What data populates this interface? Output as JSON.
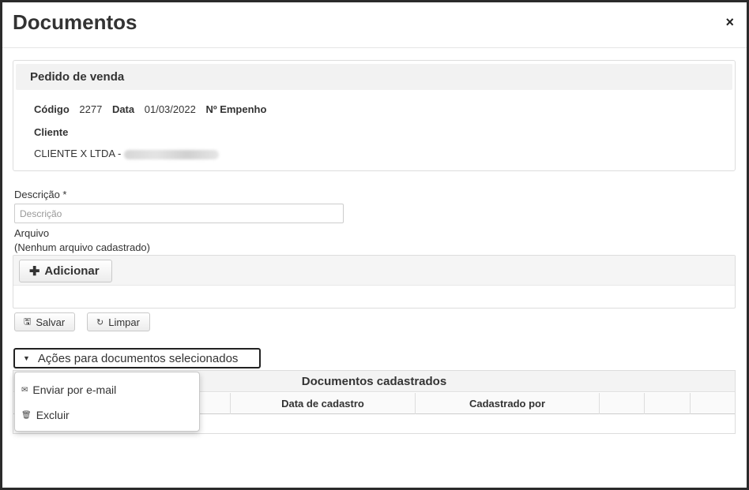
{
  "dialog": {
    "title": "Documentos",
    "close_label": "×"
  },
  "order_panel": {
    "heading": "Pedido de venda",
    "codigo_label": "Código",
    "codigo_value": "2277",
    "data_label": "Data",
    "data_value": "01/03/2022",
    "empenho_label": "Nº Empenho",
    "cliente_label": "Cliente",
    "cliente_value": "CLIENTE X LTDA -"
  },
  "form": {
    "descricao_label": "Descrição *",
    "descricao_placeholder": "Descrição",
    "descricao_value": "",
    "arquivo_label": "Arquivo",
    "arquivo_status": "(Nenhum arquivo cadastrado)",
    "adicionar_label": "Adicionar",
    "salvar_label": "Salvar",
    "limpar_label": "Limpar"
  },
  "actions": {
    "dropdown_label": "Ações para documentos selecionados",
    "menu_items": [
      {
        "label": "Enviar por e-mail",
        "icon": "envelope-icon"
      },
      {
        "label": "Excluir",
        "icon": "trash-icon"
      }
    ]
  },
  "documents_table": {
    "title": "Documentos cadastrados",
    "columns": [
      "",
      "Data de cadastro",
      "Cadastrado por",
      "",
      "",
      ""
    ],
    "rows": []
  }
}
